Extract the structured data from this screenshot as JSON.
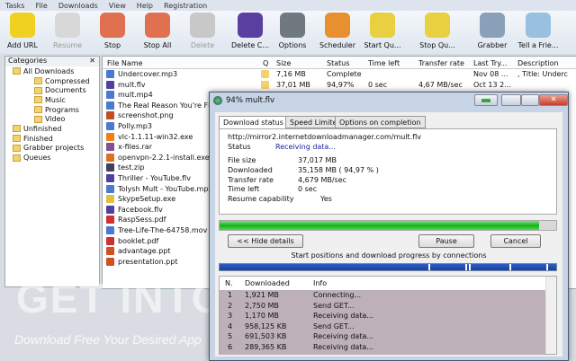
{
  "menu": [
    "Tasks",
    "File",
    "Downloads",
    "View",
    "Help",
    "Registration"
  ],
  "toolbar": [
    {
      "label": "Add URL",
      "icon": "add-url-icon",
      "color": "#f0d020",
      "enabled": true
    },
    {
      "label": "Resume",
      "icon": "resume-icon",
      "color": "#d8d8d8",
      "enabled": false
    },
    {
      "label": "Stop",
      "icon": "stop-icon",
      "color": "#e07050",
      "enabled": true
    },
    {
      "label": "Stop All",
      "icon": "stop-all-icon",
      "color": "#e07050",
      "enabled": true
    },
    {
      "label": "Delete",
      "icon": "delete-icon",
      "color": "#c8c8c8",
      "enabled": false
    },
    {
      "label": "Delete C...",
      "icon": "delete-completed-icon",
      "color": "#5a3fa0",
      "enabled": true
    },
    {
      "label": "Options",
      "icon": "gear-icon",
      "color": "#707880",
      "enabled": true
    },
    {
      "label": "Scheduler",
      "icon": "alarm-clock-icon",
      "color": "#e89030",
      "enabled": true
    },
    {
      "label": "Start Qu...",
      "icon": "start-queue-icon",
      "color": "#e8d040",
      "enabled": true
    },
    {
      "label": "Stop Qu...",
      "icon": "stop-queue-icon",
      "color": "#e8d040",
      "enabled": true
    },
    {
      "label": "Grabber",
      "icon": "grabber-icon",
      "color": "#8aa0b8",
      "enabled": true
    },
    {
      "label": "Tell a Frie...",
      "icon": "tell-friend-icon",
      "color": "#9ac0e0",
      "enabled": true
    }
  ],
  "categories": {
    "title": "Categories",
    "items": [
      {
        "label": "All Downloads",
        "level": 0
      },
      {
        "label": "Compressed",
        "level": 1
      },
      {
        "label": "Documents",
        "level": 1
      },
      {
        "label": "Music",
        "level": 1
      },
      {
        "label": "Programs",
        "level": 1
      },
      {
        "label": "Video",
        "level": 1
      },
      {
        "label": "Unfinished",
        "level": 0
      },
      {
        "label": "Finished",
        "level": 0
      },
      {
        "label": "Grabber projects",
        "level": 0
      },
      {
        "label": "Queues",
        "level": 0
      }
    ]
  },
  "list": {
    "columns": [
      "File Name",
      "Q",
      "Size",
      "Status",
      "Time left",
      "Transfer rate",
      "Last Try...",
      "Description"
    ],
    "rows": [
      {
        "name": "Undercover.mp3",
        "color": "#4a7ad0",
        "size": "7,16  MB",
        "status": "Complete",
        "time": "",
        "rate": "",
        "last": "Nov 08 ...",
        "desc": ", Title: Underc"
      },
      {
        "name": "mult.flv",
        "color": "#5040a0",
        "size": "37,01  MB",
        "status": "94,97%",
        "time": "0 sec",
        "rate": "4,67  MB/sec",
        "last": "Oct 13 2...",
        "desc": ""
      },
      {
        "name": "mult.mp4",
        "color": "#4a7ad0"
      },
      {
        "name": "The Real Reason You're Flab",
        "color": "#4a7ad0"
      },
      {
        "name": "screenshot.png",
        "color": "#c05020"
      },
      {
        "name": "Polly.mp3",
        "color": "#4a7ad0"
      },
      {
        "name": "vlc-1.1.11-win32.exe",
        "color": "#f08010"
      },
      {
        "name": "x-files.rar",
        "color": "#805090"
      },
      {
        "name": "openvpn-2.2.1-install.exe",
        "color": "#e07020"
      },
      {
        "name": "test.zip",
        "color": "#404060"
      },
      {
        "name": "Thriller - YouTube.flv",
        "color": "#5040a0"
      },
      {
        "name": "Tolysh Mult - YouTube.mp4",
        "color": "#4a7ad0"
      },
      {
        "name": "SkypeSetup.exe",
        "color": "#e0c040"
      },
      {
        "name": "Facebook.flv",
        "color": "#5040a0"
      },
      {
        "name": "RaspSess.pdf",
        "color": "#d03030"
      },
      {
        "name": "Tree-Life-The-64758.mov",
        "color": "#4a7ad0"
      },
      {
        "name": "booklet.pdf",
        "color": "#d03030"
      },
      {
        "name": "advantage.ppt",
        "color": "#d05020"
      },
      {
        "name": "presentation.ppt",
        "color": "#d05020"
      }
    ]
  },
  "dialog": {
    "title": "94% mult.flv",
    "tabs": [
      "Download status",
      "Speed Limiter",
      "Options on completion"
    ],
    "url": "http://mirror2.internetdownloadmanager.com/mult.flv",
    "status_label": "Status",
    "status_value": "Receiving data...",
    "fields": [
      {
        "label": "File size",
        "value": "37,017  MB"
      },
      {
        "label": "Downloaded",
        "value": "35,158  MB  ( 94,97 % )"
      },
      {
        "label": "Transfer rate",
        "value": "4,679  MB/sec"
      },
      {
        "label": "Time left",
        "value": "0 sec"
      },
      {
        "label": "Resume capability",
        "value": "Yes"
      }
    ],
    "progress_percent": 94.97,
    "hide_details": "<< Hide details",
    "pause": "Pause",
    "cancel": "Cancel",
    "connections_caption": "Start positions and download progress by connections",
    "conn_columns": [
      "N.",
      "Downloaded",
      "Info"
    ],
    "connections": [
      {
        "n": "1",
        "dl": "1,921  MB",
        "info": "Connecting..."
      },
      {
        "n": "2",
        "dl": "2,750  MB",
        "info": "Send GET..."
      },
      {
        "n": "3",
        "dl": "1,170  MB",
        "info": "Receiving data..."
      },
      {
        "n": "4",
        "dl": "958,125  KB",
        "info": "Send GET..."
      },
      {
        "n": "5",
        "dl": "691,503  KB",
        "info": "Receiving data..."
      },
      {
        "n": "6",
        "dl": "289,365  KB",
        "info": "Receiving data..."
      }
    ]
  },
  "watermark": {
    "title": "GET INTO PC",
    "tagline": "Download Free Your Desired App"
  }
}
